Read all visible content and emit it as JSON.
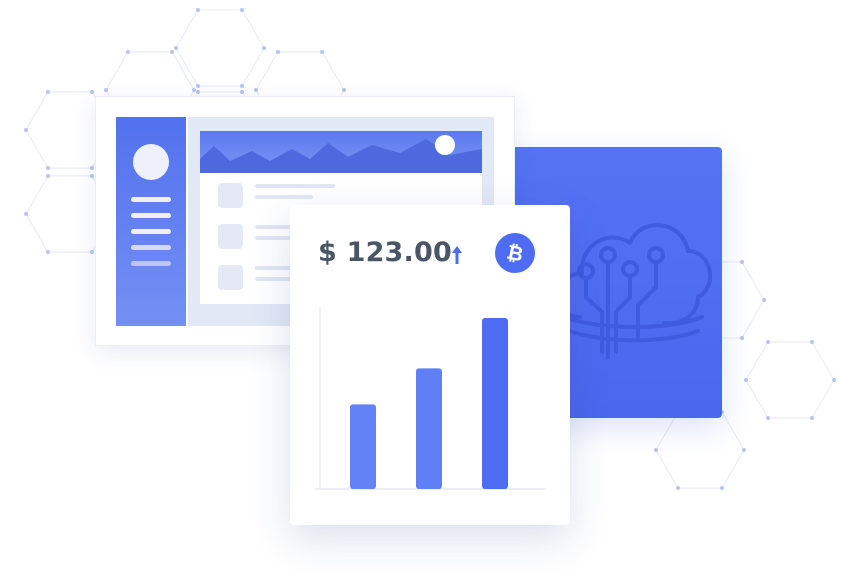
{
  "colors": {
    "accent": "#4d6cf1",
    "accent_light": "#6b88f7",
    "hex_lines": "#e6e9f8",
    "hex_dots": "#b9c4f2"
  },
  "price_card": {
    "price": "$ 123.00",
    "trend_icon": "arrow-up-icon",
    "currency_icon": "bitcoin-icon",
    "bitcoin_symbol": "₿"
  },
  "chart_data": {
    "type": "bar",
    "categories": [
      "",
      "",
      ""
    ],
    "values": [
      0.47,
      0.67,
      0.95
    ],
    "ylim": [
      0,
      1
    ],
    "grid": false
  },
  "dashboard_window": {
    "sidebar_menu_count": 5,
    "list_rows": 3
  },
  "cloud_card": {
    "icon": "cloud-circuit-icon"
  }
}
